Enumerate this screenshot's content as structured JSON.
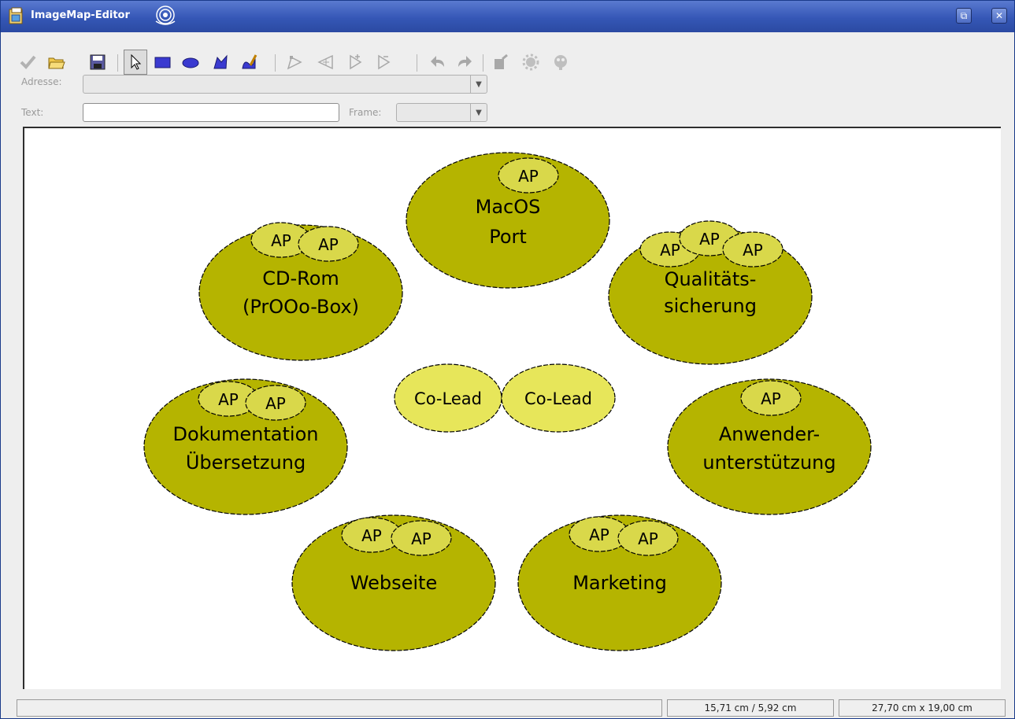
{
  "window": {
    "title": "ImageMap-Editor",
    "restore_label": "⧉",
    "close_label": "✕"
  },
  "toolbar": {
    "buttons": [
      {
        "name": "apply-icon",
        "label": "Apply",
        "enabled": false
      },
      {
        "name": "open-icon",
        "label": "Open",
        "enabled": true
      },
      {
        "name": "save-icon",
        "label": "Save",
        "enabled": true
      },
      {
        "name": "select-icon",
        "label": "Select",
        "enabled": true
      },
      {
        "name": "rectangle-icon",
        "label": "Rectangle",
        "enabled": true
      },
      {
        "name": "ellipse-icon",
        "label": "Ellipse",
        "enabled": true
      },
      {
        "name": "polygon-icon",
        "label": "Polygon",
        "enabled": true
      },
      {
        "name": "freeform-icon",
        "label": "Freeform Polygon",
        "enabled": true
      },
      {
        "name": "edit-points-icon",
        "label": "Edit Points",
        "enabled": false
      },
      {
        "name": "move-points-icon",
        "label": "Move Points",
        "enabled": false
      },
      {
        "name": "insert-points-icon",
        "label": "Insert Points",
        "enabled": false
      },
      {
        "name": "delete-points-icon",
        "label": "Delete Points",
        "enabled": false
      },
      {
        "name": "undo-icon",
        "label": "Undo",
        "enabled": false
      },
      {
        "name": "redo-icon",
        "label": "Redo",
        "enabled": false
      },
      {
        "name": "active-icon",
        "label": "Active",
        "enabled": false
      },
      {
        "name": "macro-icon",
        "label": "Macro",
        "enabled": false
      },
      {
        "name": "properties-icon",
        "label": "Properties",
        "enabled": false
      }
    ]
  },
  "fields": {
    "address_label": "Adresse:",
    "address_value": "",
    "text_label": "Text:",
    "text_value": "",
    "frame_label": "Frame:",
    "frame_value": ""
  },
  "canvas": {
    "colors": {
      "group_fill": "#b5b400",
      "ap_fill": "#d9d84a",
      "colead_fill": "#e7e65a",
      "outline": "#000000"
    },
    "groups": [
      {
        "id": "macos",
        "lines": [
          "MacOS",
          "Port"
        ],
        "ap": [
          "AP"
        ]
      },
      {
        "id": "cdrom",
        "lines": [
          "CD-Rom",
          "(PrOOo-Box)"
        ],
        "ap": [
          "AP",
          "AP"
        ]
      },
      {
        "id": "qa",
        "lines": [
          "Qualitäts-",
          "sicherung"
        ],
        "ap": [
          "AP",
          "AP",
          "AP"
        ]
      },
      {
        "id": "doku",
        "lines": [
          "Dokumentation",
          "Übersetzung"
        ],
        "ap": [
          "AP",
          "AP"
        ]
      },
      {
        "id": "support",
        "lines": [
          "Anwender-",
          "unterstützung"
        ],
        "ap": [
          "AP"
        ]
      },
      {
        "id": "web",
        "lines": [
          "Webseite"
        ],
        "ap": [
          "AP",
          "AP"
        ]
      },
      {
        "id": "marketing",
        "lines": [
          "Marketing"
        ],
        "ap": [
          "AP",
          "AP"
        ]
      }
    ],
    "colead": [
      "Co-Lead",
      "Co-Lead"
    ]
  },
  "status": {
    "message": "",
    "position": "15,71 cm / 5,92 cm",
    "size": "27,70 cm x 19,00 cm"
  }
}
